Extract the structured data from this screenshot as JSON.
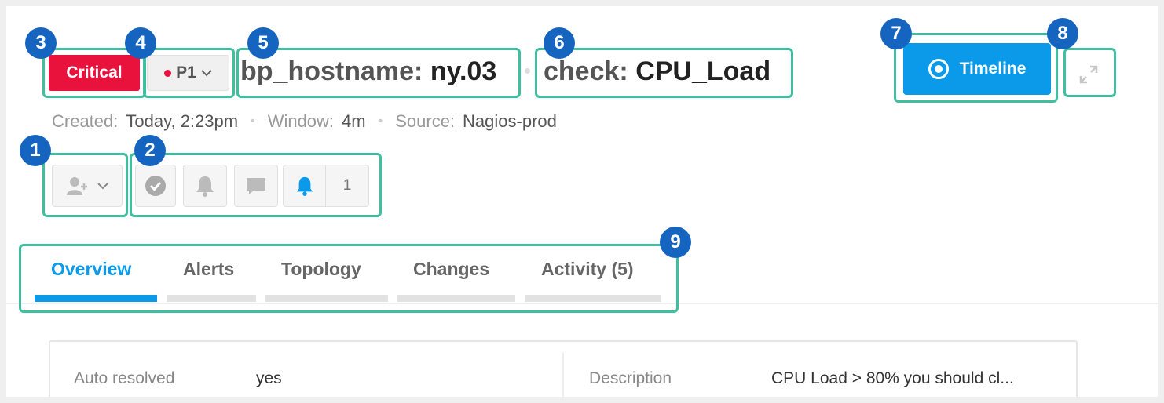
{
  "header": {
    "severity": "Critical",
    "priority": "P1",
    "title_parts": [
      {
        "key": "bp_hostname:",
        "value": "ny.03"
      },
      {
        "key": "check:",
        "value": "CPU_Load"
      }
    ],
    "timeline_label": "Timeline"
  },
  "meta": {
    "created_label": "Created:",
    "created_value": "Today, 2:23pm",
    "window_label": "Window:",
    "window_value": "4m",
    "source_label": "Source:",
    "source_value": "Nagios-prod"
  },
  "actions": {
    "notify_count": "1"
  },
  "tabs": [
    {
      "label": "Overview",
      "active": true
    },
    {
      "label": "Alerts",
      "active": false
    },
    {
      "label": "Topology",
      "active": false
    },
    {
      "label": "Changes",
      "active": false
    },
    {
      "label": "Activity (5)",
      "active": false
    }
  ],
  "details": [
    {
      "label": "Auto resolved",
      "value": "yes"
    },
    {
      "label": "Description",
      "value": "CPU Load > 80% you should cl..."
    }
  ],
  "callouts": [
    "1",
    "2",
    "3",
    "4",
    "5",
    "6",
    "7",
    "8",
    "9"
  ],
  "colors": {
    "accent": "#0a9ae9",
    "critical": "#e8123c",
    "callout": "#1565c0",
    "highlight": "#3dbfa0"
  },
  "icons": [
    "assign-user-icon",
    "chevron-down-icon",
    "acknowledge-check-icon",
    "bell-icon",
    "comment-icon",
    "bell-active-icon",
    "timeline-record-icon",
    "expand-icon"
  ]
}
